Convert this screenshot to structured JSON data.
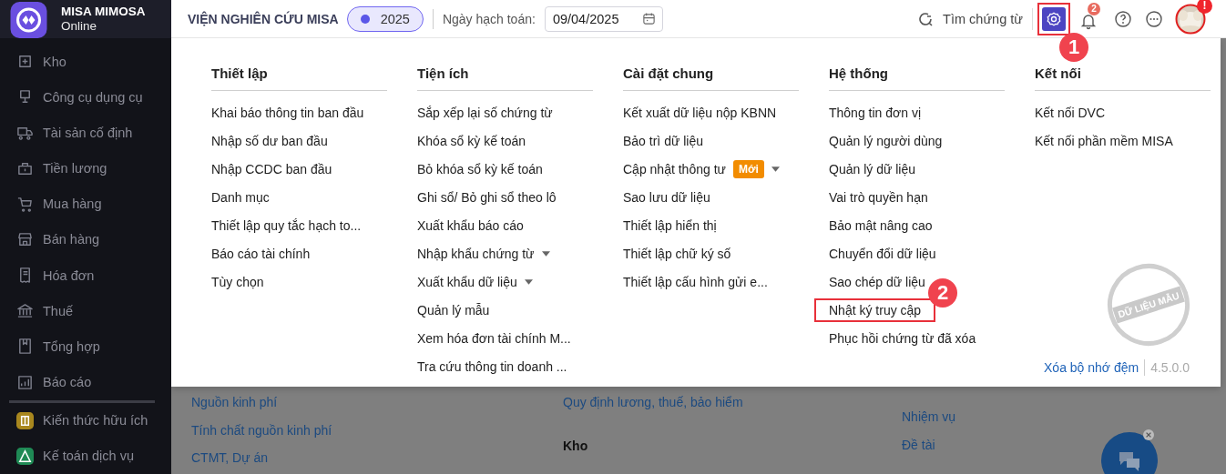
{
  "app": {
    "name": "MISA MIMOSA",
    "edition": "Online"
  },
  "sidebar": {
    "items": [
      {
        "label": "Kho",
        "kind": "module"
      },
      {
        "label": "Công cụ dụng cụ",
        "kind": "module"
      },
      {
        "label": "Tài sản cố định",
        "kind": "module"
      },
      {
        "label": "Tiền lương",
        "kind": "module"
      },
      {
        "label": "Mua hàng",
        "kind": "module"
      },
      {
        "label": "Bán hàng",
        "kind": "module"
      },
      {
        "label": "Hóa đơn",
        "kind": "module"
      },
      {
        "label": "Thuế",
        "kind": "module"
      },
      {
        "label": "Tổng hợp",
        "kind": "module"
      },
      {
        "label": "Báo cáo",
        "kind": "module"
      },
      {
        "label": "Kiến thức hữu ích",
        "kind": "extra",
        "color": "#a8871e"
      },
      {
        "label": "Kế toán dịch vụ",
        "kind": "extra",
        "color": "#1f8a55"
      }
    ]
  },
  "topbar": {
    "organization": "VIỆN NGHIÊN CỨU MISA",
    "year": "2025",
    "date_label": "Ngày hạch toán:",
    "date_value": "09/04/2025",
    "search": "Tìm chứng từ",
    "settings": {
      "highlighted": true,
      "callout": "1"
    },
    "notification_count": "2",
    "avatar_alert": "!"
  },
  "menu": {
    "columns": [
      {
        "title": "Thiết lập",
        "items": [
          {
            "label": "Khai báo thông tin ban đầu",
            "kind": "link"
          },
          {
            "label": "Nhập số dư ban đầu",
            "kind": "link"
          },
          {
            "label": "Nhập CCDC ban đầu",
            "kind": "link"
          },
          {
            "label": "Danh mục",
            "kind": "link"
          },
          {
            "label": "Thiết lập quy tắc hạch to...",
            "kind": "link"
          },
          {
            "label": "Báo cáo tài chính",
            "kind": "link"
          },
          {
            "label": "Tùy chọn",
            "kind": "link"
          }
        ]
      },
      {
        "title": "Tiện ích",
        "items": [
          {
            "label": "Sắp xếp lại số chứng từ",
            "kind": "link"
          },
          {
            "label": "Khóa sổ kỳ kế toán",
            "kind": "link"
          },
          {
            "label": "Bỏ khóa sổ kỳ kế toán",
            "kind": "link"
          },
          {
            "label": "Ghi sổ/ Bỏ ghi sổ theo lô",
            "kind": "link"
          },
          {
            "label": "Xuất khẩu báo cáo",
            "kind": "link"
          },
          {
            "label": "Nhập khẩu chứng từ",
            "kind": "submenu"
          },
          {
            "label": "Xuất khẩu dữ liệu",
            "kind": "submenu"
          },
          {
            "label": "Quản lý mẫu",
            "kind": "link"
          },
          {
            "label": "Xem hóa đơn tài chính M...",
            "kind": "link"
          },
          {
            "label": "Tra cứu thông tin doanh ...",
            "kind": "link"
          }
        ]
      },
      {
        "title": "Cài đặt chung",
        "items": [
          {
            "label": "Kết xuất dữ liệu nộp KBNN",
            "kind": "link"
          },
          {
            "label": "Bảo trì dữ liệu",
            "kind": "link"
          },
          {
            "label": "Cập nhật thông tư",
            "kind": "submenu",
            "badge": "Mới"
          },
          {
            "label": "Sao lưu dữ liệu",
            "kind": "link"
          },
          {
            "label": "Thiết lập hiển thị",
            "kind": "link"
          },
          {
            "label": "Thiết lập chữ ký số",
            "kind": "link"
          },
          {
            "label": "Thiết lập cấu hình gửi e...",
            "kind": "link"
          }
        ]
      },
      {
        "title": "Hệ thống",
        "items": [
          {
            "label": "Thông tin đơn vị",
            "kind": "link"
          },
          {
            "label": "Quản lý người dùng",
            "kind": "link"
          },
          {
            "label": "Quản lý dữ liệu",
            "kind": "link"
          },
          {
            "label": "Vai trò quyền hạn",
            "kind": "link"
          },
          {
            "label": "Bảo mật nâng cao",
            "kind": "link"
          },
          {
            "label": "Chuyển đổi dữ liệu",
            "kind": "link"
          },
          {
            "label": "Sao chép dữ liệu",
            "kind": "link"
          },
          {
            "label": "Nhật ký truy cập",
            "kind": "link",
            "highlighted": true,
            "callout": "2"
          },
          {
            "label": "Phục hồi chứng từ đã xóa",
            "kind": "link"
          }
        ]
      },
      {
        "title": "Kết nối",
        "items": [
          {
            "label": "Kết nối DVC",
            "kind": "link"
          },
          {
            "label": "Kết nối phần mềm MISA",
            "kind": "link"
          }
        ]
      }
    ],
    "stamp": "DỮ LIỆU MẪU",
    "clear_cache": "Xóa bộ nhớ đệm",
    "version": "4.5.0.0"
  },
  "background": {
    "columns": [
      {
        "items": [
          {
            "label": "Nguồn kinh phí",
            "kind": "link"
          },
          {
            "label": "Tính chất nguồn kinh phí",
            "kind": "link"
          },
          {
            "label": "CTMT, Dự án",
            "kind": "link"
          }
        ]
      },
      {
        "items": [
          {
            "label": "Quy định lương, thuế, bảo hiểm",
            "kind": "link"
          },
          {
            "label": "Kho",
            "kind": "heading"
          }
        ]
      },
      {
        "items": [
          {
            "label": "Nhiệm vụ",
            "kind": "link"
          },
          {
            "label": "Đề tài",
            "kind": "link"
          }
        ]
      }
    ]
  }
}
